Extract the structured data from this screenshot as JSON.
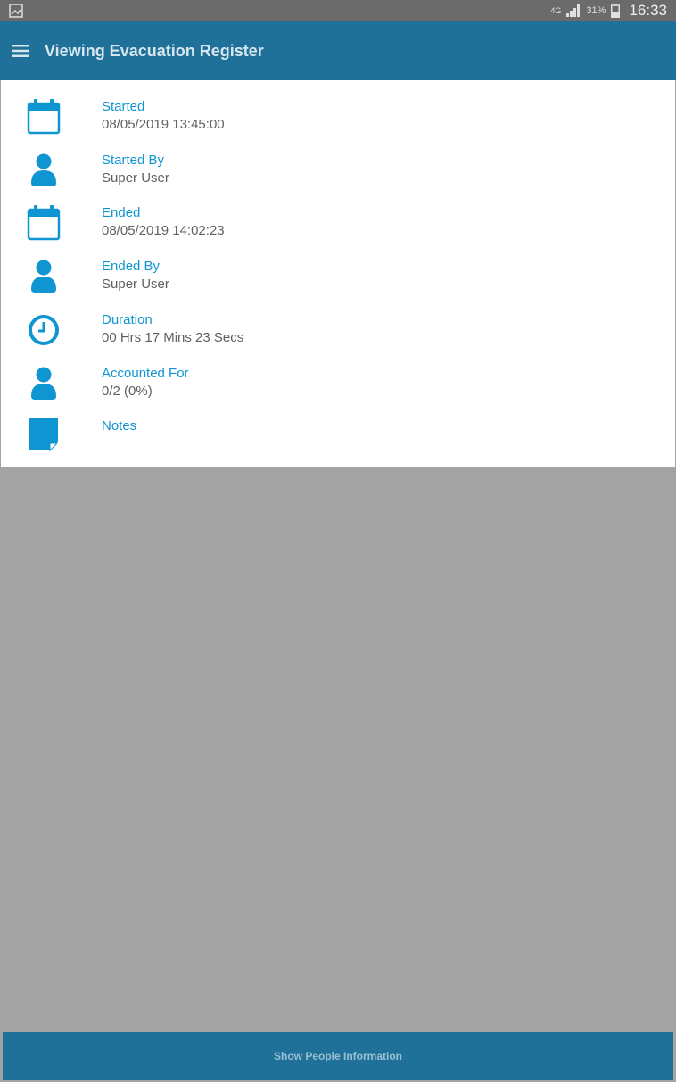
{
  "status_bar": {
    "network": "4G",
    "battery": "31%",
    "time": "16:33"
  },
  "app_bar": {
    "title": "Viewing Evacuation Register"
  },
  "details": [
    {
      "label": "Started",
      "value": "08/05/2019 13:45:00",
      "icon": "calendar-icon"
    },
    {
      "label": "Started By",
      "value": "Super User",
      "icon": "person-icon"
    },
    {
      "label": "Ended",
      "value": "08/05/2019 14:02:23",
      "icon": "calendar-icon"
    },
    {
      "label": "Ended By",
      "value": "Super User",
      "icon": "person-icon"
    },
    {
      "label": "Duration",
      "value": "00 Hrs 17 Mins 23 Secs",
      "icon": "clock-icon"
    },
    {
      "label": "Accounted For",
      "value": "0/2 (0%)",
      "icon": "person-icon"
    },
    {
      "label": "Notes",
      "value": "",
      "icon": "note-icon"
    }
  ],
  "bottom_button": {
    "label": "Show People Information"
  },
  "colors": {
    "app_bar": "#1f7199",
    "accent": "#0f95d1",
    "content_bg": "#a3a3a3"
  }
}
